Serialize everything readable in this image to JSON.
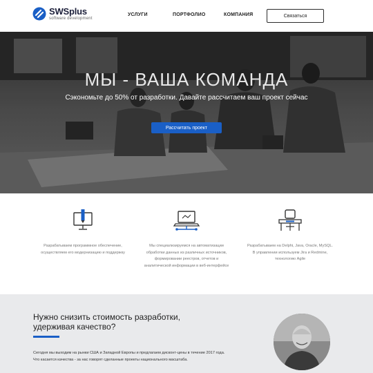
{
  "header": {
    "logo_name": "SWSplus",
    "logo_sub": "software development",
    "nav": [
      "УСЛУГИ",
      "ПОРТФОЛИО",
      "КОМПАНИЯ"
    ],
    "contact_label": "Связаться"
  },
  "hero": {
    "title": "МЫ - ВАША КОМАНДА",
    "subtitle": "Сэкономьте до 50% от разработки. Давайте рассчитаем ваш проект сейчас",
    "button_label": "Рассчитать проект"
  },
  "features": [
    {
      "icon": "monitor-pencil-icon",
      "text": "Разрабатываем программное обеспечение, осуществляем его модернизацию и поддержку"
    },
    {
      "icon": "laptop-network-icon",
      "text": "Мы специализируемся на автоматизации обработки данных из различных источников, формировании реестров, отчетов и аналитической информации в веб-интерфейсе"
    },
    {
      "icon": "developer-desk-icon",
      "text": "Разрабатываем на Delphi, Java, Oracle, MySQL. В управлении используем Jira и Redmine, технологию Agile"
    }
  ],
  "bottom": {
    "heading": "Нужно снизить стоимость разработки, удерживая качество?",
    "text_line1": "Сегодня мы выходим на рынки США и Западной Европы и предлагаем дисконт-цены в течение 2017 года.",
    "text_line2": "Что касается качества - за нас говорят сделанные проекты национального масштаба."
  },
  "colors": {
    "accent": "#1a5fc6",
    "hero_overlay": "#4b4b4b",
    "section_bg": "#e9eaec"
  }
}
